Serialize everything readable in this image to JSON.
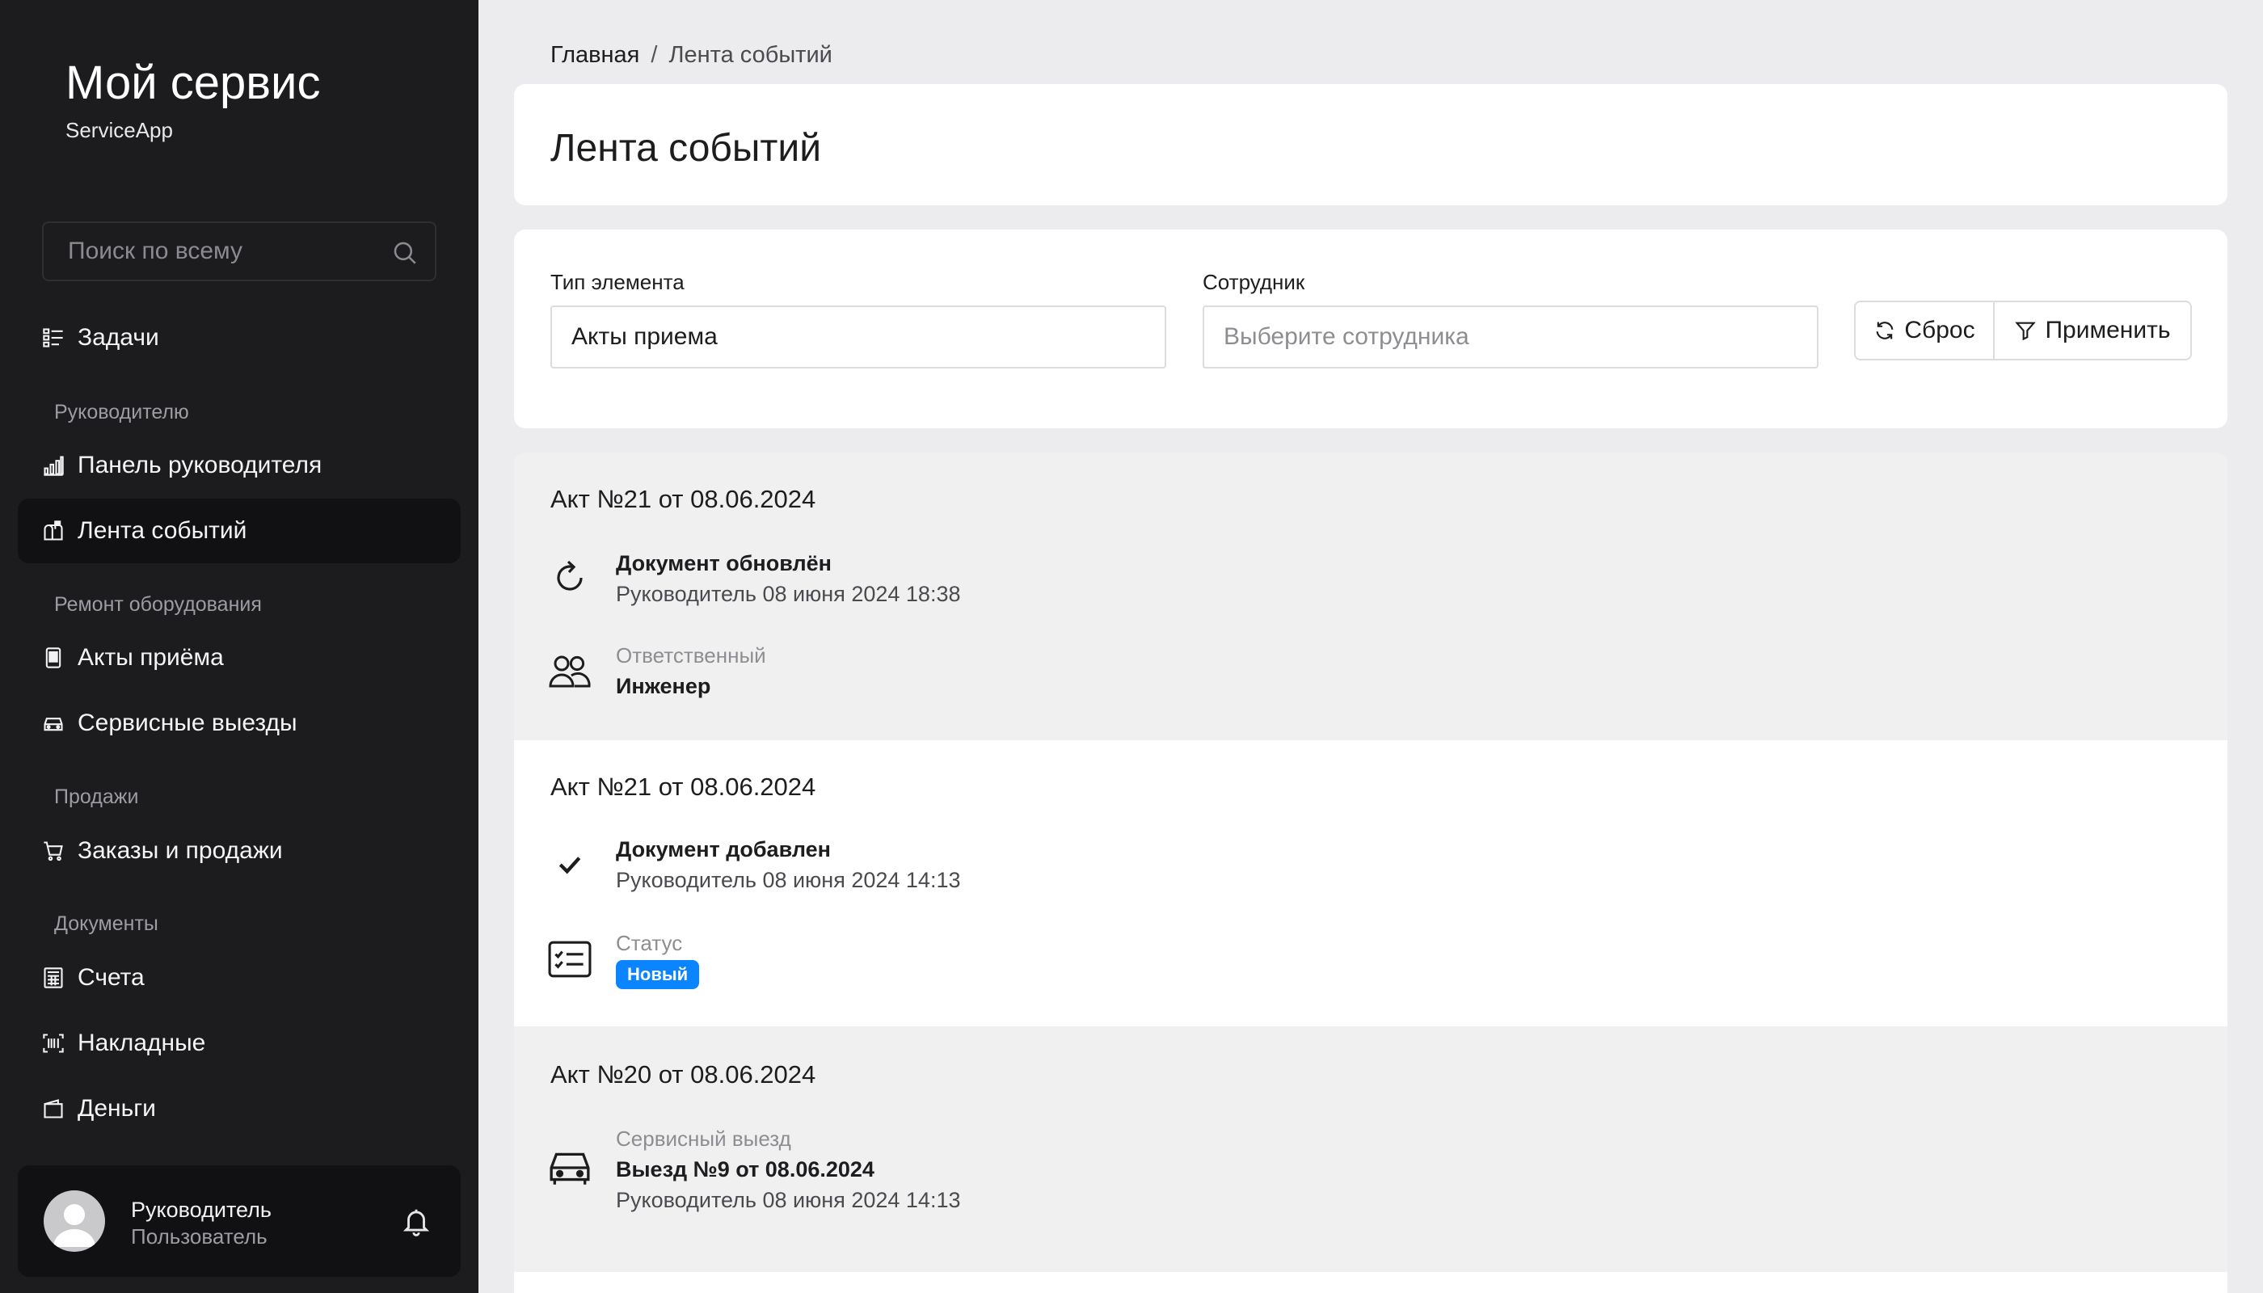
{
  "brand": {
    "title": "Мой сервис",
    "subtitle": "ServiceApp"
  },
  "search": {
    "placeholder": "Поиск по всему"
  },
  "nav": {
    "tasks": "Задачи",
    "section_manager": "Руководителю",
    "dashboard": "Панель руководителя",
    "feed": "Лента событий",
    "section_repair": "Ремонт оборудования",
    "acceptance": "Акты приёма",
    "service_trips": "Сервисные выезды",
    "section_sales": "Продажи",
    "orders": "Заказы и продажи",
    "section_docs": "Документы",
    "invoices": "Счета",
    "waybills": "Накладные",
    "money": "Деньги"
  },
  "user": {
    "name": "Руководитель",
    "role": "Пользователь"
  },
  "breadcrumb": {
    "home": "Главная",
    "separator": "/",
    "current": "Лента событий"
  },
  "page": {
    "title": "Лента событий"
  },
  "filters": {
    "type_label": "Тип элемента",
    "type_value": "Акты приема",
    "employee_label": "Сотрудник",
    "employee_placeholder": "Выберите сотрудника",
    "reset": "Сброс",
    "apply": "Применить"
  },
  "feed": [
    {
      "title": "Акт №21 от 08.06.2024",
      "event": {
        "icon": "refresh-icon",
        "title": "Документ обновлён",
        "meta": "Руководитель 08 июня 2024 18:38"
      },
      "detail": {
        "icon": "users-icon",
        "label": "Ответственный",
        "value": "Инженер"
      }
    },
    {
      "title": "Акт №21 от 08.06.2024",
      "event": {
        "icon": "checkmark-icon",
        "title": "Документ добавлен",
        "meta": "Руководитель 08 июня 2024 14:13"
      },
      "detail": {
        "icon": "checklist-icon",
        "label": "Статус",
        "badge": "Новый"
      }
    },
    {
      "title": "Акт №20 от 08.06.2024",
      "event": {
        "icon": "car-icon",
        "label": "Сервисный выезд",
        "title": "Выезд №9 от 08.06.2024",
        "meta": "Руководитель 08 июня 2024 14:13"
      }
    }
  ],
  "colors": {
    "sidebar_bg": "#1c1c1f",
    "accent": "#0a84ff",
    "page_bg": "#ececee"
  }
}
